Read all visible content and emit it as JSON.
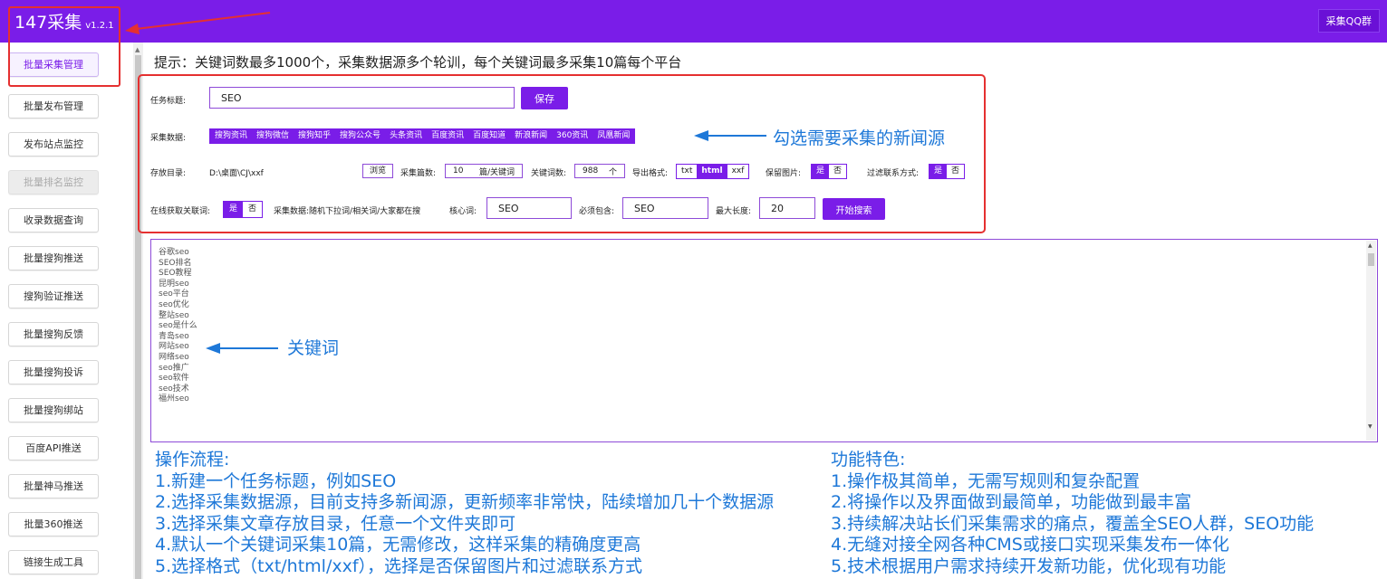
{
  "app": {
    "title": "147采集",
    "version": "v1.2.1",
    "qq_button": "采集QQ群"
  },
  "sidebar": {
    "items": [
      {
        "label": "批量采集管理"
      },
      {
        "label": "批量发布管理"
      },
      {
        "label": "发布站点监控"
      },
      {
        "label": "批量排名监控"
      },
      {
        "label": "收录数据查询"
      },
      {
        "label": "批量搜狗推送"
      },
      {
        "label": "搜狗验证推送"
      },
      {
        "label": "批量搜狗反馈"
      },
      {
        "label": "批量搜狗投诉"
      },
      {
        "label": "批量搜狗绑站"
      },
      {
        "label": "百度API推送"
      },
      {
        "label": "批量神马推送"
      },
      {
        "label": "批量360推送"
      },
      {
        "label": "链接生成工具"
      }
    ]
  },
  "tip": "提示：关键词数最多1000个，采集数据源多个轮训，每个关键词最多采集10篇每个平台",
  "form": {
    "task_title_label": "任务标题:",
    "task_title_value": "SEO",
    "save_label": "保存",
    "sources_label": "采集数据:",
    "sources": [
      {
        "label": "搜狗资讯",
        "selected": false
      },
      {
        "label": "搜狗微信",
        "selected": true
      },
      {
        "label": "搜狗知乎",
        "selected": true
      },
      {
        "label": "搜狗公众号",
        "selected": true
      },
      {
        "label": "头条资讯",
        "selected": true
      },
      {
        "label": "百度资讯",
        "selected": false
      },
      {
        "label": "百度知道",
        "selected": true
      },
      {
        "label": "新浪新闻",
        "selected": true
      },
      {
        "label": "360资讯",
        "selected": false
      },
      {
        "label": "凤凰新闻",
        "selected": true
      }
    ],
    "dir_label": "存放目录:",
    "dir_value": "D:\\桌面\\CJ\\xxf",
    "browse_label": "浏览",
    "count_label": "采集篇数:",
    "count_value": "10",
    "count_unit": "篇/关键词",
    "kwcount_label": "关键词数:",
    "kwcount_value": "988",
    "kwcount_unit": "个",
    "export_label": "导出格式:",
    "export_options": [
      {
        "label": "txt",
        "selected": false
      },
      {
        "label": "html",
        "selected": true
      },
      {
        "label": "xxf",
        "selected": false
      }
    ],
    "keep_img_label": "保留图片:",
    "filter_label": "过滤联系方式:",
    "online_label": "在线获取关联词:",
    "yes": "是",
    "no": "否",
    "hint": "采集数据:随机下拉词/相关词/大家都在搜",
    "core_label": "核心词:",
    "core_value": "SEO",
    "must_label": "必须包含:",
    "must_value": "SEO",
    "maxlen_label": "最大长度:",
    "maxlen_value": "20",
    "search_label": "开始搜索"
  },
  "annotations": {
    "sources": "勾选需要采集的新闻源",
    "keywords": "关键词"
  },
  "keywords": [
    "谷歌seo",
    "SEO排名",
    "SEO教程",
    "昆明seo",
    "seo平台",
    "seo优化",
    "整站seo",
    "seo是什么",
    "青岛seo",
    "网站seo",
    "网络seo",
    "seo推广",
    "seo软件",
    "seo技术",
    "福州seo"
  ],
  "process": {
    "title": "操作流程:",
    "steps": [
      "1.新建一个任务标题，例如SEO",
      "2.选择采集数据源，目前支持多新闻源，更新频率非常快，陆续增加几十个数据源",
      "3.选择采集文章存放目录，任意一个文件夹即可",
      "4.默认一个关键词采集10篇，无需修改，这样采集的精确度更高",
      "5.选择格式（txt/html/xxf），选择是否保留图片和过滤联系方式"
    ]
  },
  "features": {
    "title": "功能特色:",
    "items": [
      "1.操作极其简单，无需写规则和复杂配置",
      "2.将操作以及界面做到最简单，功能做到最丰富",
      "3.持续解决站长们采集需求的痛点，覆盖全SEO人群，SEO功能",
      "4.无缝对接全网各种CMS或接口实现采集发布一体化",
      "5.技术根据用户需求持续开发新功能，优化现有功能"
    ]
  },
  "colors": {
    "brand": "#7a1de8",
    "annotation_blue": "#1e78d8",
    "annotation_red": "#e53030"
  }
}
